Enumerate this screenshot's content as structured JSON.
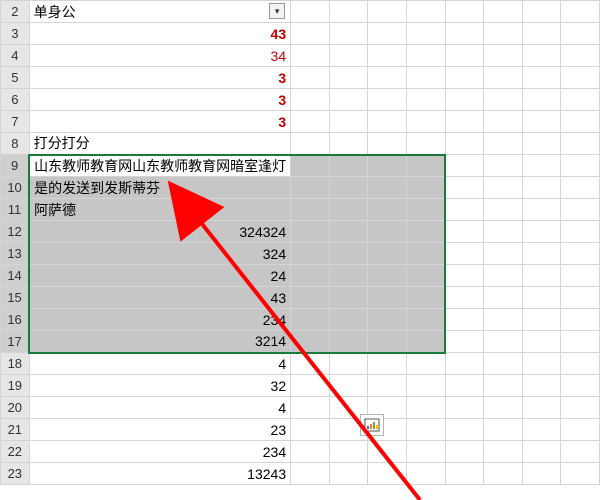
{
  "rows": {
    "r2": {
      "num": "2",
      "a": "单身公",
      "cls": "txt",
      "filter": true
    },
    "r3": {
      "num": "3",
      "a": "43",
      "cls": "num bold red"
    },
    "r4": {
      "num": "4",
      "a": "34",
      "cls": "num red"
    },
    "r5": {
      "num": "5",
      "a": "3",
      "cls": "num bold red"
    },
    "r6": {
      "num": "6",
      "a": "3",
      "cls": "num bold red"
    },
    "r7": {
      "num": "7",
      "a": "3",
      "cls": "num bold red"
    },
    "r8": {
      "num": "8",
      "a": "打分打分",
      "cls": "txt"
    },
    "r9": {
      "num": "9",
      "a": "山东教师教育网山东教师教育网暗室逢灯",
      "cls": "txt"
    },
    "r10": {
      "num": "10",
      "a": "是的发送到发斯蒂芬",
      "cls": "txt"
    },
    "r11": {
      "num": "11",
      "a": "阿萨德",
      "cls": "txt"
    },
    "r12": {
      "num": "12",
      "a": "324324",
      "cls": "num"
    },
    "r13": {
      "num": "13",
      "a": "324",
      "cls": "num"
    },
    "r14": {
      "num": "14",
      "a": "24",
      "cls": "num"
    },
    "r15": {
      "num": "15",
      "a": "43",
      "cls": "num"
    },
    "r16": {
      "num": "16",
      "a": "234",
      "cls": "num"
    },
    "r17": {
      "num": "17",
      "a": "3214",
      "cls": "num"
    },
    "r18": {
      "num": "18",
      "a": "4",
      "cls": "num"
    },
    "r19": {
      "num": "19",
      "a": "32",
      "cls": "num"
    },
    "r20": {
      "num": "20",
      "a": "4",
      "cls": "num"
    },
    "r21": {
      "num": "21",
      "a": "23",
      "cls": "num"
    },
    "r22": {
      "num": "22",
      "a": "234",
      "cls": "num"
    },
    "r23": {
      "num": "23",
      "a": "13243",
      "cls": "num"
    }
  },
  "filter_glyph": "▾",
  "selection": {
    "from_row": 9,
    "to_row": 17,
    "from_col": 1,
    "to_col": 5
  }
}
